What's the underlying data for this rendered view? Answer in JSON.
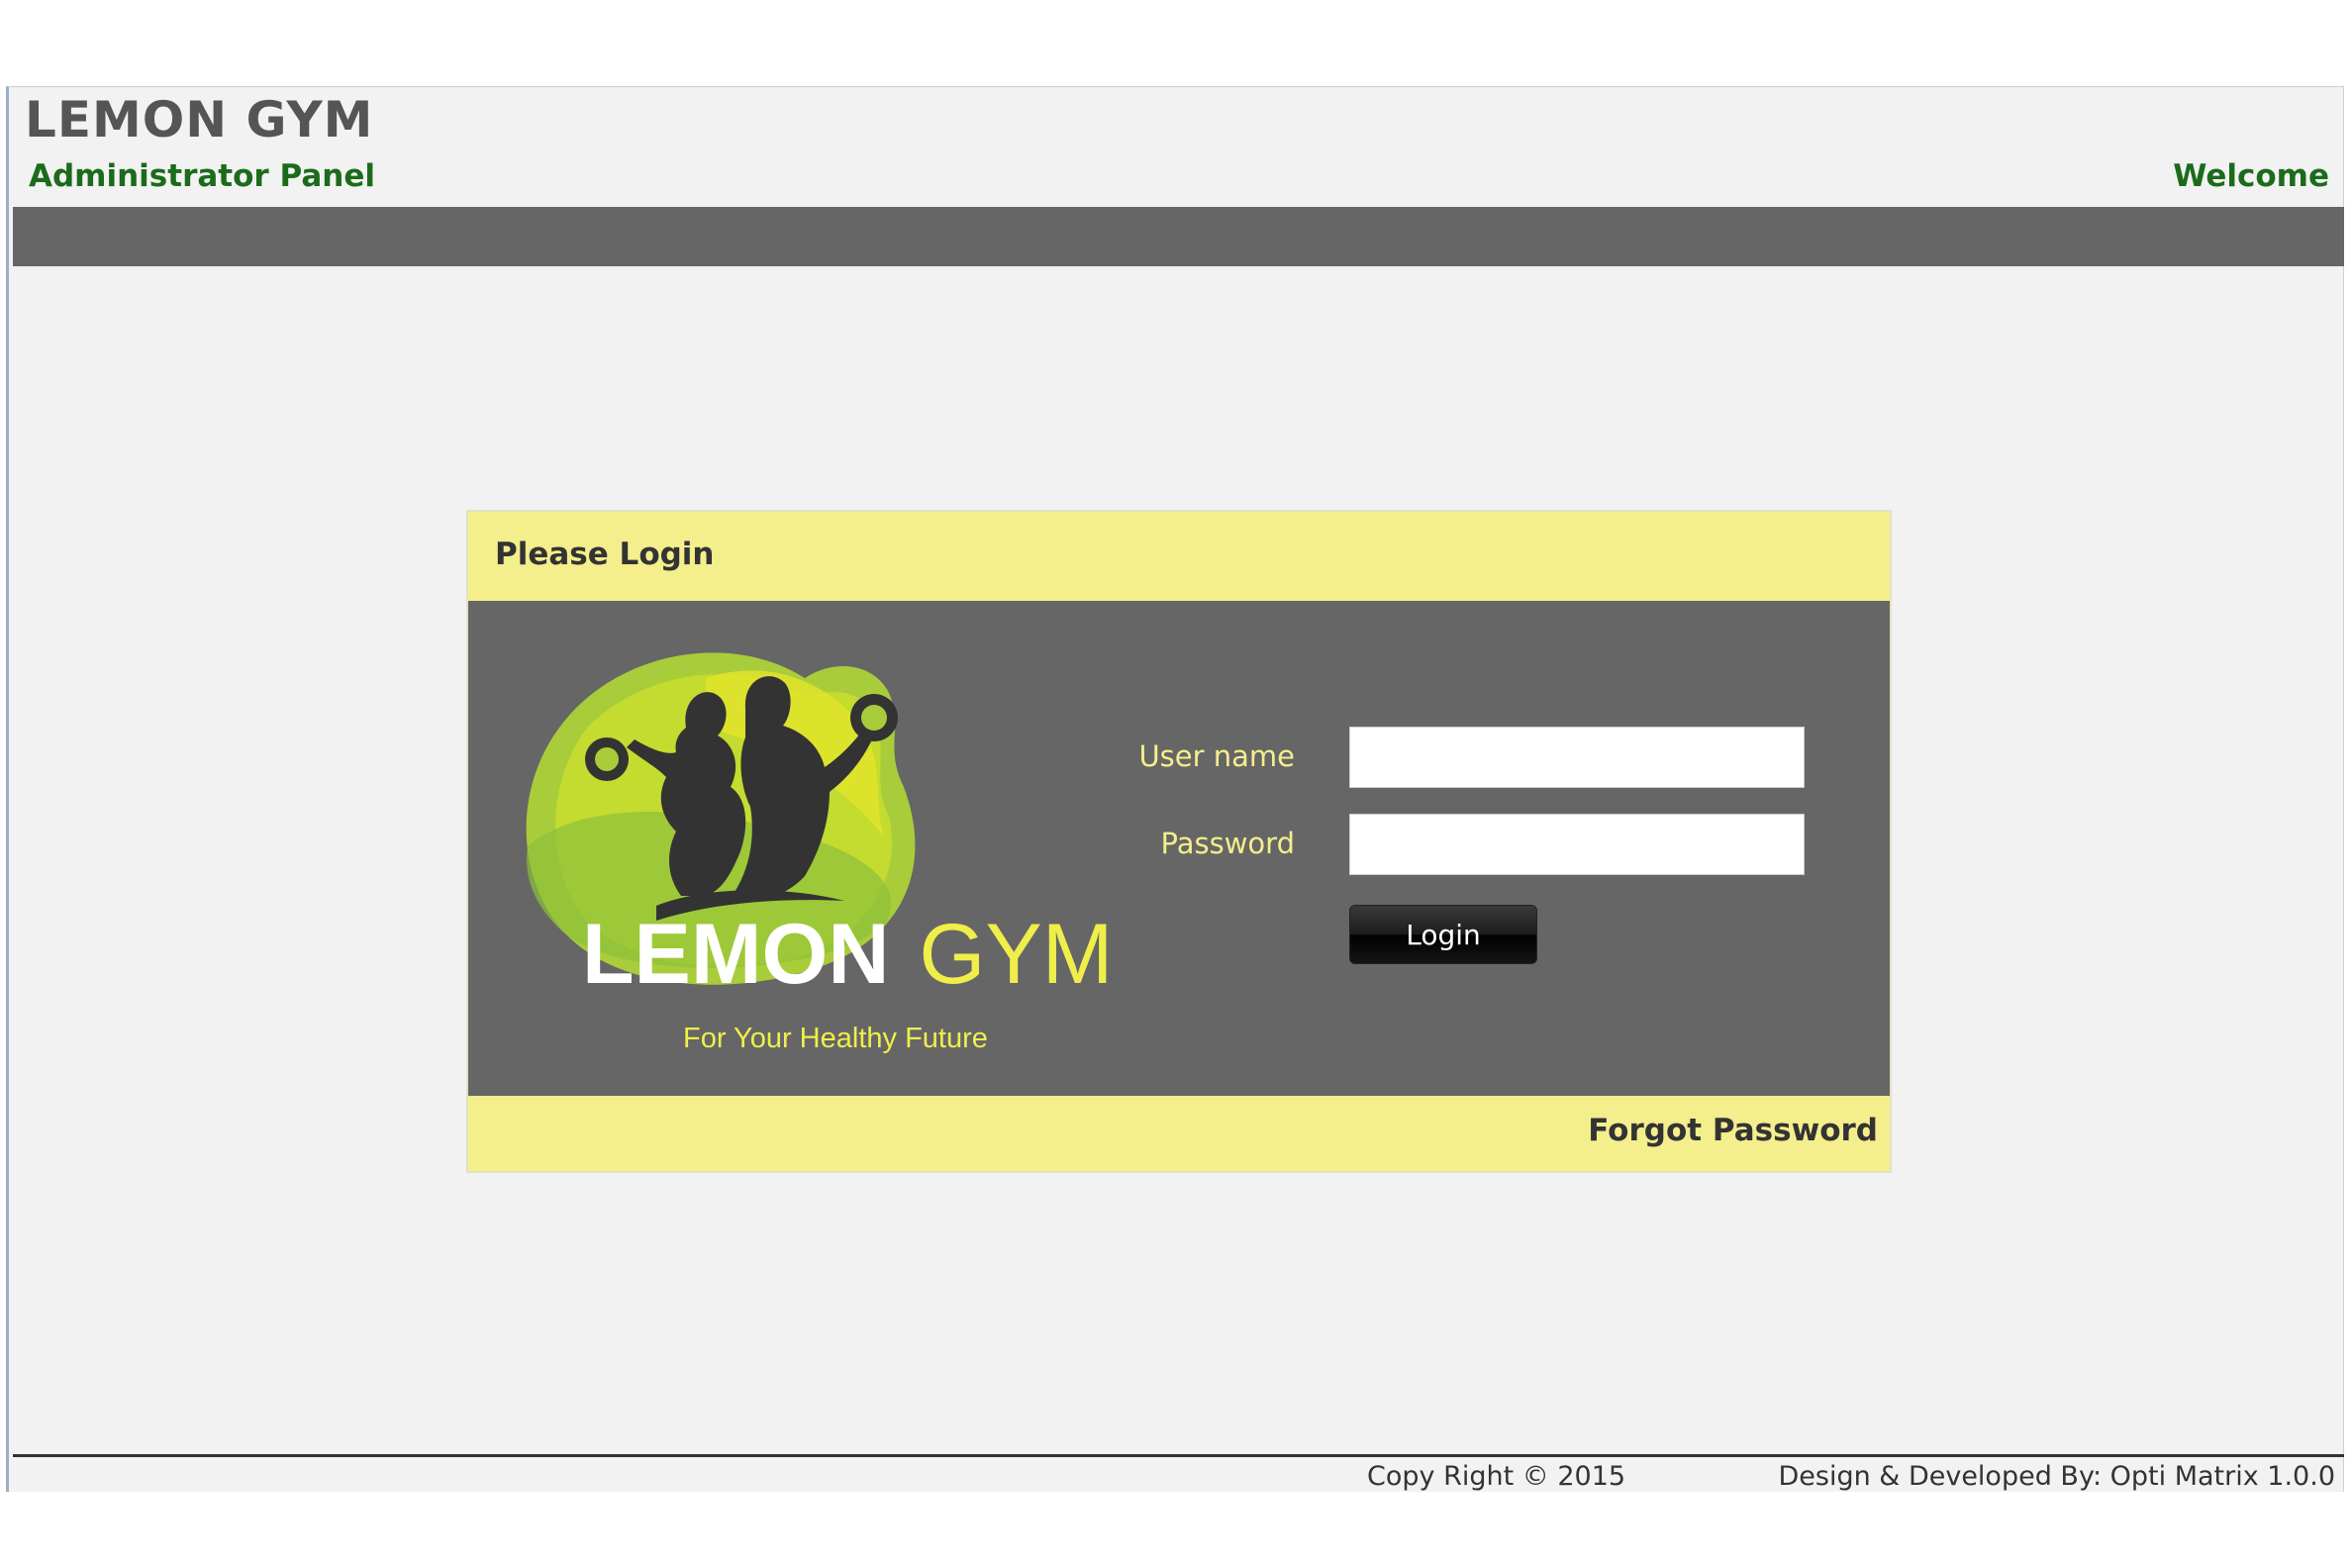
{
  "header": {
    "title": "LEMON GYM",
    "subtitle": "Administrator Panel",
    "welcome": "Welcome"
  },
  "login": {
    "heading": "Please Login",
    "username_label": "User name",
    "username_value": "",
    "password_label": "Password",
    "password_value": "",
    "login_button": "Login",
    "forgot_password": "Forgot Password"
  },
  "logo": {
    "word1": "LEMON",
    "word2": "GYM",
    "tagline": "For Your Healthy Future"
  },
  "footer": {
    "copyright": "Copy Right © 2015",
    "developer": "Design & Developed By: Opti Matrix 1.0.0"
  },
  "colors": {
    "accent_yellow": "#f4ee8c",
    "panel_gray": "#666666",
    "brand_green": "#1b6b1b",
    "logo_lime": "#b8d42a"
  }
}
